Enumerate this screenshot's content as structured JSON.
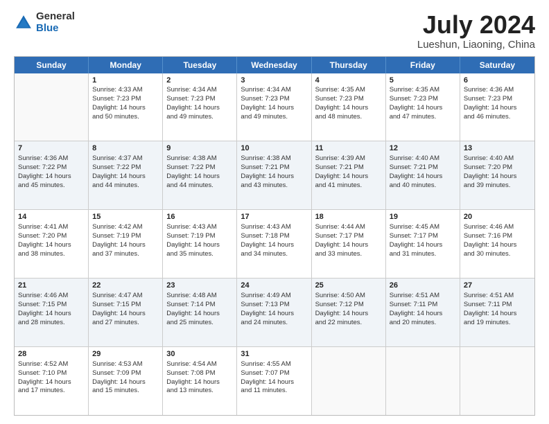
{
  "logo": {
    "general": "General",
    "blue": "Blue"
  },
  "title": "July 2024",
  "subtitle": "Lueshun, Liaoning, China",
  "days": [
    "Sunday",
    "Monday",
    "Tuesday",
    "Wednesday",
    "Thursday",
    "Friday",
    "Saturday"
  ],
  "rows": [
    [
      {
        "num": "",
        "rise": "",
        "set": "",
        "day": "",
        "min": "",
        "empty": true
      },
      {
        "num": "1",
        "rise": "Sunrise: 4:33 AM",
        "set": "Sunset: 7:23 PM",
        "day": "Daylight: 14 hours",
        "min": "and 50 minutes."
      },
      {
        "num": "2",
        "rise": "Sunrise: 4:34 AM",
        "set": "Sunset: 7:23 PM",
        "day": "Daylight: 14 hours",
        "min": "and 49 minutes."
      },
      {
        "num": "3",
        "rise": "Sunrise: 4:34 AM",
        "set": "Sunset: 7:23 PM",
        "day": "Daylight: 14 hours",
        "min": "and 49 minutes."
      },
      {
        "num": "4",
        "rise": "Sunrise: 4:35 AM",
        "set": "Sunset: 7:23 PM",
        "day": "Daylight: 14 hours",
        "min": "and 48 minutes."
      },
      {
        "num": "5",
        "rise": "Sunrise: 4:35 AM",
        "set": "Sunset: 7:23 PM",
        "day": "Daylight: 14 hours",
        "min": "and 47 minutes."
      },
      {
        "num": "6",
        "rise": "Sunrise: 4:36 AM",
        "set": "Sunset: 7:23 PM",
        "day": "Daylight: 14 hours",
        "min": "and 46 minutes."
      }
    ],
    [
      {
        "num": "7",
        "rise": "Sunrise: 4:36 AM",
        "set": "Sunset: 7:22 PM",
        "day": "Daylight: 14 hours",
        "min": "and 45 minutes."
      },
      {
        "num": "8",
        "rise": "Sunrise: 4:37 AM",
        "set": "Sunset: 7:22 PM",
        "day": "Daylight: 14 hours",
        "min": "and 44 minutes."
      },
      {
        "num": "9",
        "rise": "Sunrise: 4:38 AM",
        "set": "Sunset: 7:22 PM",
        "day": "Daylight: 14 hours",
        "min": "and 44 minutes."
      },
      {
        "num": "10",
        "rise": "Sunrise: 4:38 AM",
        "set": "Sunset: 7:21 PM",
        "day": "Daylight: 14 hours",
        "min": "and 43 minutes."
      },
      {
        "num": "11",
        "rise": "Sunrise: 4:39 AM",
        "set": "Sunset: 7:21 PM",
        "day": "Daylight: 14 hours",
        "min": "and 41 minutes."
      },
      {
        "num": "12",
        "rise": "Sunrise: 4:40 AM",
        "set": "Sunset: 7:21 PM",
        "day": "Daylight: 14 hours",
        "min": "and 40 minutes."
      },
      {
        "num": "13",
        "rise": "Sunrise: 4:40 AM",
        "set": "Sunset: 7:20 PM",
        "day": "Daylight: 14 hours",
        "min": "and 39 minutes."
      }
    ],
    [
      {
        "num": "14",
        "rise": "Sunrise: 4:41 AM",
        "set": "Sunset: 7:20 PM",
        "day": "Daylight: 14 hours",
        "min": "and 38 minutes."
      },
      {
        "num": "15",
        "rise": "Sunrise: 4:42 AM",
        "set": "Sunset: 7:19 PM",
        "day": "Daylight: 14 hours",
        "min": "and 37 minutes."
      },
      {
        "num": "16",
        "rise": "Sunrise: 4:43 AM",
        "set": "Sunset: 7:19 PM",
        "day": "Daylight: 14 hours",
        "min": "and 35 minutes."
      },
      {
        "num": "17",
        "rise": "Sunrise: 4:43 AM",
        "set": "Sunset: 7:18 PM",
        "day": "Daylight: 14 hours",
        "min": "and 34 minutes."
      },
      {
        "num": "18",
        "rise": "Sunrise: 4:44 AM",
        "set": "Sunset: 7:17 PM",
        "day": "Daylight: 14 hours",
        "min": "and 33 minutes."
      },
      {
        "num": "19",
        "rise": "Sunrise: 4:45 AM",
        "set": "Sunset: 7:17 PM",
        "day": "Daylight: 14 hours",
        "min": "and 31 minutes."
      },
      {
        "num": "20",
        "rise": "Sunrise: 4:46 AM",
        "set": "Sunset: 7:16 PM",
        "day": "Daylight: 14 hours",
        "min": "and 30 minutes."
      }
    ],
    [
      {
        "num": "21",
        "rise": "Sunrise: 4:46 AM",
        "set": "Sunset: 7:15 PM",
        "day": "Daylight: 14 hours",
        "min": "and 28 minutes."
      },
      {
        "num": "22",
        "rise": "Sunrise: 4:47 AM",
        "set": "Sunset: 7:15 PM",
        "day": "Daylight: 14 hours",
        "min": "and 27 minutes."
      },
      {
        "num": "23",
        "rise": "Sunrise: 4:48 AM",
        "set": "Sunset: 7:14 PM",
        "day": "Daylight: 14 hours",
        "min": "and 25 minutes."
      },
      {
        "num": "24",
        "rise": "Sunrise: 4:49 AM",
        "set": "Sunset: 7:13 PM",
        "day": "Daylight: 14 hours",
        "min": "and 24 minutes."
      },
      {
        "num": "25",
        "rise": "Sunrise: 4:50 AM",
        "set": "Sunset: 7:12 PM",
        "day": "Daylight: 14 hours",
        "min": "and 22 minutes."
      },
      {
        "num": "26",
        "rise": "Sunrise: 4:51 AM",
        "set": "Sunset: 7:11 PM",
        "day": "Daylight: 14 hours",
        "min": "and 20 minutes."
      },
      {
        "num": "27",
        "rise": "Sunrise: 4:51 AM",
        "set": "Sunset: 7:11 PM",
        "day": "Daylight: 14 hours",
        "min": "and 19 minutes."
      }
    ],
    [
      {
        "num": "28",
        "rise": "Sunrise: 4:52 AM",
        "set": "Sunset: 7:10 PM",
        "day": "Daylight: 14 hours",
        "min": "and 17 minutes."
      },
      {
        "num": "29",
        "rise": "Sunrise: 4:53 AM",
        "set": "Sunset: 7:09 PM",
        "day": "Daylight: 14 hours",
        "min": "and 15 minutes."
      },
      {
        "num": "30",
        "rise": "Sunrise: 4:54 AM",
        "set": "Sunset: 7:08 PM",
        "day": "Daylight: 14 hours",
        "min": "and 13 minutes."
      },
      {
        "num": "31",
        "rise": "Sunrise: 4:55 AM",
        "set": "Sunset: 7:07 PM",
        "day": "Daylight: 14 hours",
        "min": "and 11 minutes."
      },
      {
        "num": "",
        "rise": "",
        "set": "",
        "day": "",
        "min": "",
        "empty": true
      },
      {
        "num": "",
        "rise": "",
        "set": "",
        "day": "",
        "min": "",
        "empty": true
      },
      {
        "num": "",
        "rise": "",
        "set": "",
        "day": "",
        "min": "",
        "empty": true
      }
    ]
  ]
}
